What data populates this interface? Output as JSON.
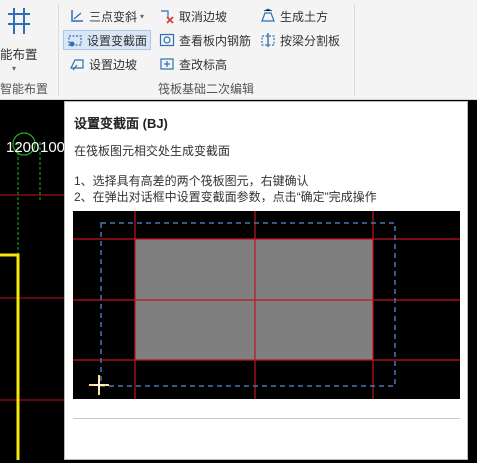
{
  "ribbon": {
    "smart_layout": {
      "label": "能布置",
      "icon": "grid-layout-icon"
    },
    "group_left_label": "智能布置",
    "group_right_label": "筏板基础二次编辑",
    "buttons": {
      "three_point_slope": {
        "label": "三点变斜",
        "icon": "three-point-slope-icon"
      },
      "set_change_section": {
        "label": "设置变截面",
        "icon": "change-section-icon"
      },
      "set_edge_slope": {
        "label": "设置边坡",
        "icon": "edge-slope-icon"
      },
      "cancel_edge_slope": {
        "label": "取消边坡",
        "icon": "cancel-slope-icon"
      },
      "view_inner_rebar": {
        "label": "查看板内钢筋",
        "icon": "rebar-view-icon"
      },
      "check_edit_elevation": {
        "label": "查改标高",
        "icon": "elevation-icon"
      },
      "generate_earthwork": {
        "label": "生成土方",
        "icon": "earthwork-icon"
      },
      "split_by_beam": {
        "label": "按梁分割板",
        "icon": "beam-split-icon"
      }
    }
  },
  "canvas": {
    "axis_label_top": "1200",
    "axis_label_right": "100"
  },
  "tooltip": {
    "title": "设置变截面 (BJ)",
    "description": "在筏板图元相交处生成变截面",
    "step1": "1、选择具有高差的两个筏板图元，右键确认",
    "step2": "2、在弹出对话框中设置变截面参数，点击“确定”完成操作"
  },
  "colors": {
    "ribbon_bg": "#f4f4f4",
    "active_button_bg": "#d8e6f5",
    "icon_blue": "#2f6fb6",
    "grid_red": "#c0141b",
    "slab_gray": "#7f7f7f",
    "dashed_blue": "#4a74b8",
    "wall_yellow": "#f4e60f",
    "green": "#1db51d"
  }
}
